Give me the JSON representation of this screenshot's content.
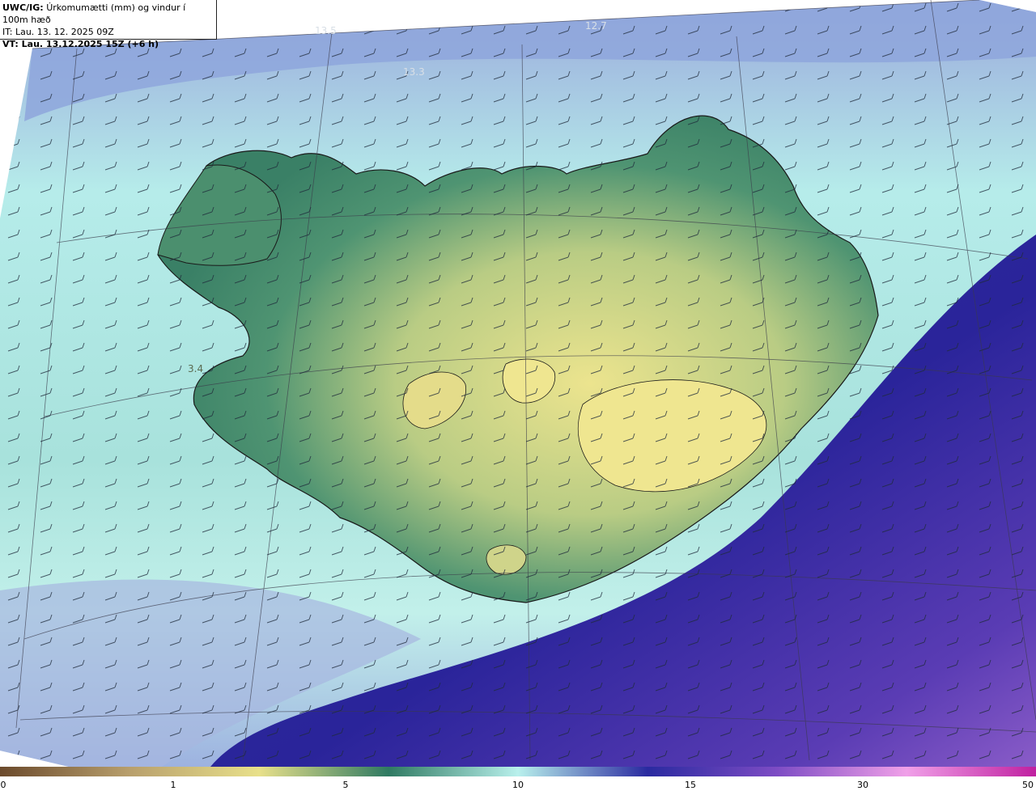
{
  "header": {
    "model": "UWC/IG:",
    "title": "Úrkomumætti (mm) og vindur í 100m hæð",
    "issue_time": "IT: Lau. 13. 12. 2025 09Z",
    "valid_time": "VT: Lau. 13.12.2025 15Z (+6 h)"
  },
  "map_labels": [
    "13.5",
    "12.7",
    "13.3",
    "3.4"
  ],
  "colorbar": {
    "ticks": [
      "0",
      "1",
      "5",
      "10",
      "15",
      "30",
      "50"
    ],
    "colors": [
      "#6b4a2c",
      "#b89f6c",
      "#e8e08a",
      "#2f7a62",
      "#b8f0ec",
      "#2a2aa0",
      "#7d4cc4",
      "#f0a0e8",
      "#c020a0"
    ]
  },
  "colors": {
    "land_yellow": "#e7df8e",
    "land_green": "#3f8a6a",
    "sea_cyan": "#b9eeea",
    "sea_blue": "#8fa9de",
    "ocean_navy": "#27249a",
    "ocean_purple": "#7e55c8"
  }
}
